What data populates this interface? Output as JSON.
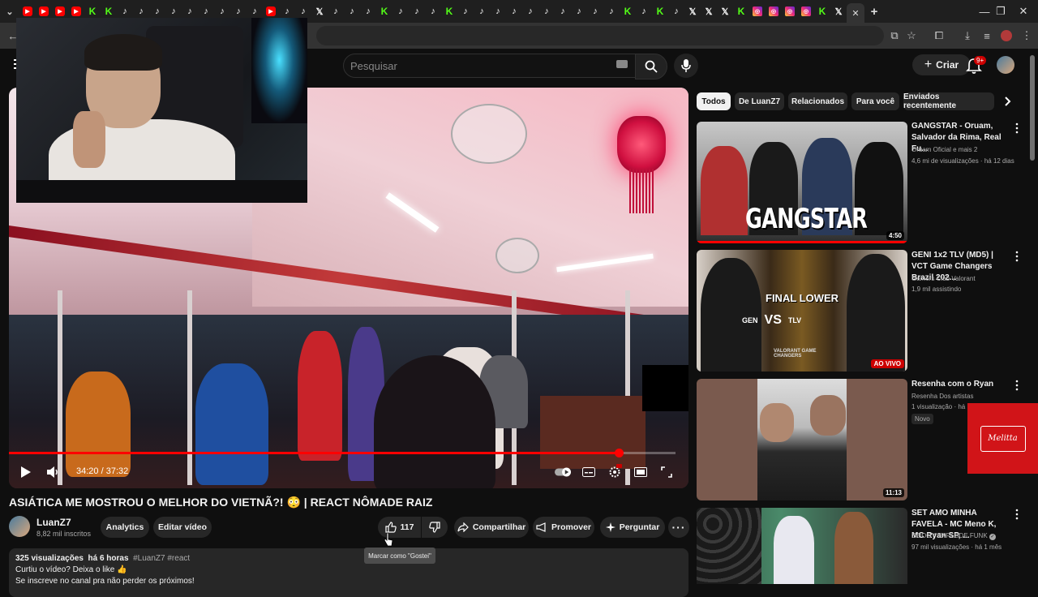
{
  "browser": {
    "tab_icons": [
      "yt",
      "yt",
      "yt",
      "yt",
      "kk",
      "kk",
      "tk",
      "tk",
      "tk",
      "tk",
      "tk",
      "tk",
      "tk",
      "tk",
      "tk",
      "yt",
      "tk",
      "tk",
      "xx",
      "tk",
      "tk",
      "tk",
      "kk",
      "tk",
      "tk",
      "tk",
      "kk",
      "tk",
      "tk",
      "tk",
      "tk",
      "tk",
      "tk",
      "tk",
      "tk",
      "tk",
      "tk",
      "kk",
      "tk",
      "kk",
      "tk",
      "xx",
      "xx",
      "xx",
      "kk",
      "ig",
      "ig",
      "ig",
      "ig",
      "kk",
      "xx"
    ],
    "close_tab_symbol": "✕",
    "new_tab_symbol": "+",
    "minimize_symbol": "—",
    "maximize_symbol": "❐",
    "close_window_symbol": "✕"
  },
  "header": {
    "search_placeholder": "Pesquisar",
    "create_label": "Criar",
    "notification_count": "9+"
  },
  "player": {
    "current_time": "34:20",
    "duration": "37:32",
    "progress_fraction": 0.915
  },
  "video": {
    "title": "ASIÁTICA ME MOSTROU O MELHOR DO VIETNÃ?! 😳 | REACT NÔMADE RAIZ",
    "channel_name": "LuanZ7",
    "subscribers": "8,82 mil inscritos",
    "analytics_label": "Analytics",
    "edit_label": "Editar vídeo",
    "like_count": "117",
    "share_label": "Compartilhar",
    "promote_label": "Promover",
    "ask_label": "Perguntar",
    "tooltip": "Marcar como \"Gostei\""
  },
  "description": {
    "views": "325 visualizações",
    "time_ago": "há 6 horas",
    "tags": "#LuanZ7 #react",
    "line1": "Curtiu o vídeo? Deixa o like 👍",
    "line2": "Se inscreve no canal pra não perder os próximos!"
  },
  "chips": [
    "Todos",
    "De LuanZ7",
    "Relacionados",
    "Para você",
    "Enviados recentemente"
  ],
  "recommendations": [
    {
      "title": "GANGSTAR - Oruam, Salvador da Rima, Real Fu...",
      "channel": "Oruam Oficial e mais 2",
      "meta": "4,6 mi de visualizações · há 12 dias",
      "badge": "4:50",
      "thumb_text": "GANGSTAR"
    },
    {
      "title": "GENI 1x2 TLV (MD5) | VCT Game Changers Brazil 202...",
      "channel": "Gamers Club Valorant",
      "meta": "1,9 mil assistindo",
      "badge": "AO VIVO",
      "thumb_text": "FINAL LOWER",
      "thumb_sub": "VALORANT GAME CHANGERS",
      "team_a": "GEN",
      "team_b": "TLV",
      "vs": "VS"
    },
    {
      "title": "Resenha com o Ryan",
      "channel": "Resenha Dos artistas",
      "meta": "1 visualização · há",
      "badge": "11:13",
      "tag": "Novo"
    },
    {
      "title": "SET AMO MINHA FAVELA - MC Meno K, MC Ryan SP, ...",
      "channel": "GODOY EXPLODE FUNK",
      "meta": "97 mil visualizações · há 1 mês"
    }
  ],
  "ad": {
    "brand": "Melitta"
  }
}
